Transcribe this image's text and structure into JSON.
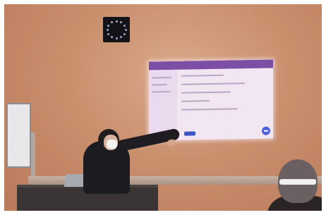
{
  "scene": {
    "subject": "presenter",
    "clock_dots": 12
  }
}
